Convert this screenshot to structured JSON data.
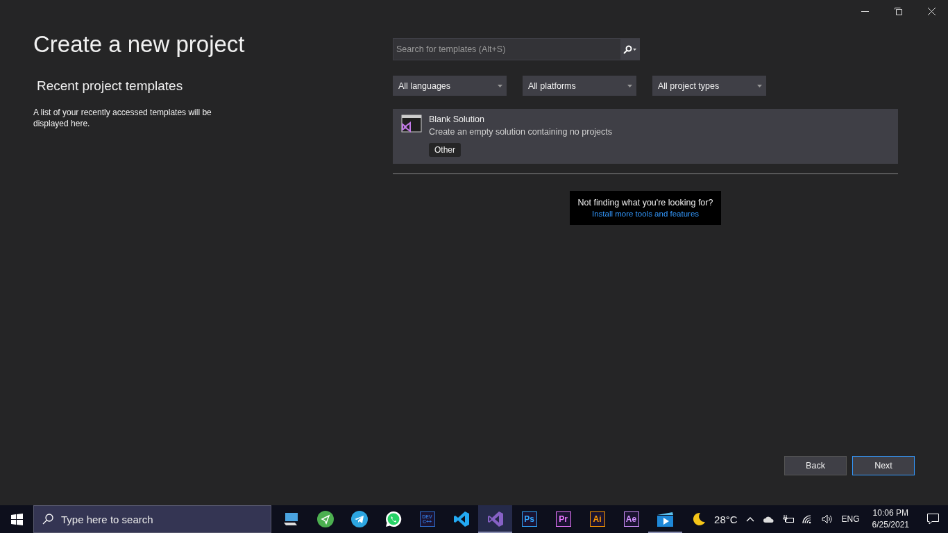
{
  "window": {
    "title": "Create a new project"
  },
  "recent": {
    "heading": "Recent project templates",
    "message": "A list of your recently accessed templates will be displayed here."
  },
  "search": {
    "placeholder": "Search for templates (Alt+S)"
  },
  "filters": [
    {
      "label": "All languages"
    },
    {
      "label": "All platforms"
    },
    {
      "label": "All project types"
    }
  ],
  "templates": [
    {
      "name": "Blank Solution",
      "description": "Create an empty solution containing no projects",
      "tags": [
        "Other"
      ],
      "selected": true
    }
  ],
  "hint": {
    "text": "Not finding what you're looking for?",
    "link": "Install more tools and features"
  },
  "buttons": [
    {
      "label": "Back",
      "kind": "secondary"
    },
    {
      "label": "Next",
      "kind": "primary"
    }
  ],
  "taskbar": {
    "search_placeholder": "Type here to search",
    "apps": [
      {
        "kind": "computer",
        "selected": false,
        "running": false
      },
      {
        "kind": "plane-circle",
        "selected": false,
        "running": false
      },
      {
        "kind": "telegram",
        "selected": false,
        "running": false
      },
      {
        "kind": "whatsapp",
        "selected": false,
        "running": false
      },
      {
        "kind": "text",
        "label": "DEV C++",
        "color": "#2f6fd0",
        "selected": false,
        "running": false
      },
      {
        "kind": "vscode",
        "selected": false,
        "running": false
      },
      {
        "kind": "vs",
        "selected": true,
        "running": true
      },
      {
        "kind": "text",
        "label": "Ps",
        "color": "#31a8ff",
        "selected": false,
        "running": false
      },
      {
        "kind": "text",
        "label": "Pr",
        "color": "#ea77ff",
        "selected": false,
        "running": false
      },
      {
        "kind": "text",
        "label": "Ai",
        "color": "#ff9a00",
        "selected": false,
        "running": false
      },
      {
        "kind": "text",
        "label": "Ae",
        "color": "#d291ff",
        "selected": false,
        "running": false
      },
      {
        "kind": "video",
        "selected": false,
        "running": true
      }
    ],
    "weather": "28°C",
    "language": "ENG",
    "time": "10:06 PM",
    "date": "6/25/2021"
  }
}
